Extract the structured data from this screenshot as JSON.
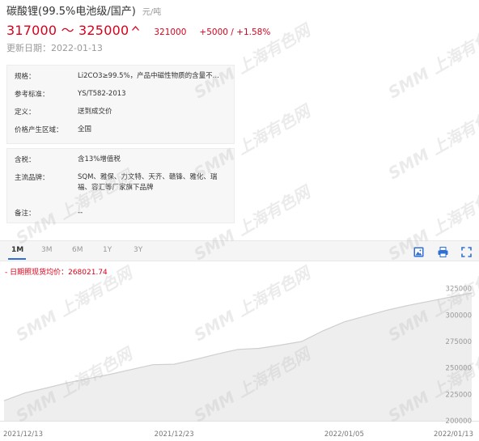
{
  "product": {
    "title": "碳酸锂(99.5%电池级/国产)",
    "unit": "元/吨"
  },
  "price": {
    "range": "317000 ～ 325000",
    "trend_icon": "up-arrow-icon",
    "average": "321000",
    "change": "+5000 / +1.58%",
    "color": "#d9001b"
  },
  "updated": "更新日期：2022-01-13",
  "spec_rows": [
    {
      "key": "规格：",
      "value": "Li2CO3≥99.5%，产品中磁性物质的含量不..."
    },
    {
      "key": "参考标准：",
      "value": "YS/T582-2013"
    },
    {
      "key": "定义：",
      "value": "送到成交价"
    },
    {
      "key": "价格产生区域：",
      "value": "全国"
    }
  ],
  "detail_rows": [
    {
      "key": "含税：",
      "value": "含13%增值税"
    },
    {
      "key": "主流品牌：",
      "value": "SQM、雅保、力文特、天齐、赣锋、雅化、瑞福、容汇等厂家旗下品牌"
    },
    {
      "key": "备注：",
      "value": "--"
    }
  ],
  "tabs": [
    "1M",
    "3M",
    "6M",
    "1Y",
    "3Y"
  ],
  "active_tab": "1M",
  "tools": [
    "image-icon",
    "print-icon",
    "fullscreen-icon"
  ],
  "watermark": "SMM 上海有色网",
  "chart_data": {
    "type": "area",
    "legend": "日期照现货均价：268021.74",
    "x": [
      "2021-12-13",
      "2021-12-14",
      "2021-12-15",
      "2021-12-16",
      "2021-12-17",
      "2021-12-20",
      "2021-12-21",
      "2021-12-22",
      "2021-12-23",
      "2021-12-24",
      "2021-12-27",
      "2021-12-28",
      "2021-12-29",
      "2021-12-30",
      "2021-12-31",
      "2022-01-04",
      "2022-01-05",
      "2022-01-06",
      "2022-01-07",
      "2022-01-10",
      "2022-01-11",
      "2022-01-12",
      "2022-01-13"
    ],
    "values": [
      219000,
      226500,
      231000,
      236000,
      240000,
      244000,
      248500,
      253000,
      253500,
      258000,
      263000,
      267500,
      268500,
      271500,
      275000,
      285000,
      293500,
      299000,
      304500,
      309000,
      313000,
      317000,
      321000
    ],
    "x_ticks": [
      "2021/12/13",
      "2021/12/23",
      "2022/01/05",
      "2022/01/13"
    ],
    "x_tick_index": [
      0,
      8,
      16,
      22
    ],
    "y_ticks": [
      200000,
      225000,
      250000,
      275000,
      300000,
      325000
    ],
    "ylim": [
      200000,
      327000
    ],
    "line_color": "#cfcfcf",
    "fill_color": "#eeeeee"
  }
}
